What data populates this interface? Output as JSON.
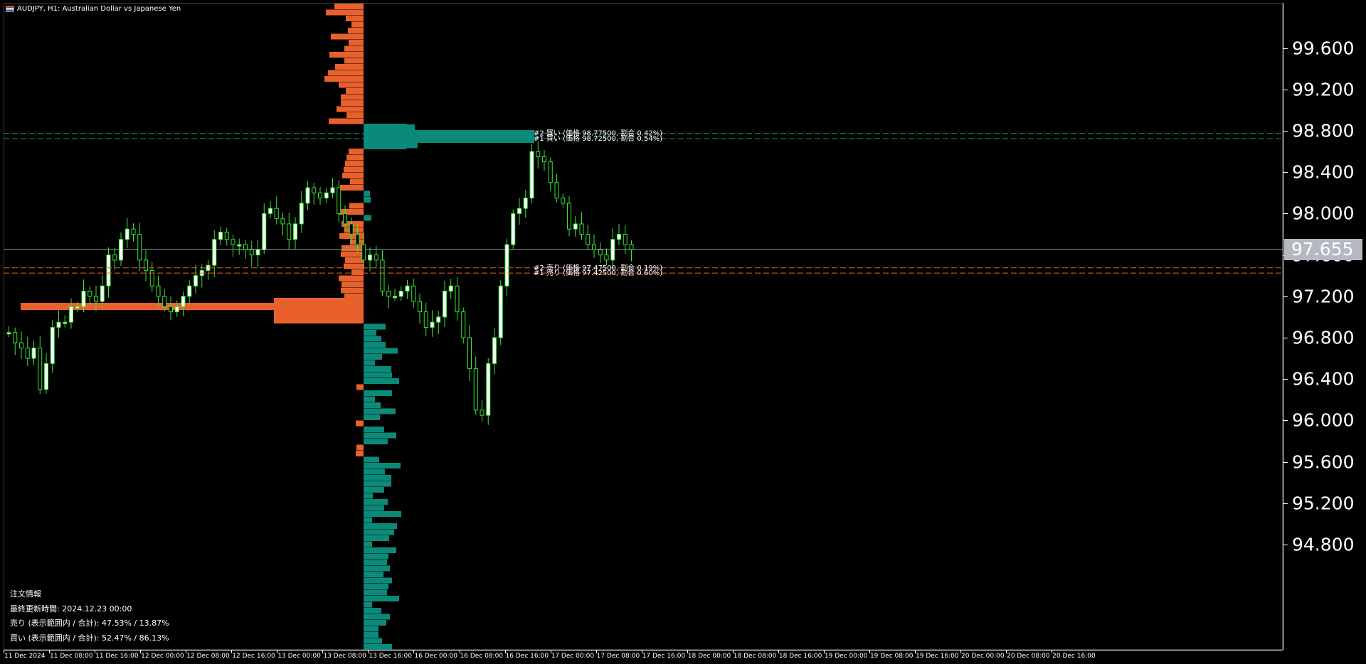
{
  "window_title": "AUDJPY, H1:  Australian Dollar vs Japanese Yen",
  "price_axis": {
    "labels": [
      "99.600",
      "99.200",
      "98.800",
      "98.400",
      "98.000",
      "97.600",
      "97.200",
      "96.800",
      "96.400",
      "96.000",
      "95.600",
      "95.200",
      "94.800"
    ],
    "current_price": "97.655"
  },
  "time_axis": {
    "labels": [
      "11 Dec 2024",
      "11 Dec 08:00",
      "11 Dec 16:00",
      "12 Dec 00:00",
      "12 Dec 08:00",
      "12 Dec 16:00",
      "13 Dec 00:00",
      "13 Dec 08:00",
      "13 Dec 16:00",
      "16 Dec 00:00",
      "16 Dec 08:00",
      "16 Dec 16:00",
      "17 Dec 00:00",
      "17 Dec 08:00",
      "17 Dec 16:00",
      "18 Dec 00:00",
      "18 Dec 08:00",
      "18 Dec 16:00",
      "19 Dec 00:00",
      "19 Dec 08:00",
      "19 Dec 16:00",
      "20 Dec 00:00",
      "20 Dec 08:00",
      "20 Dec 16:00"
    ]
  },
  "order_lines": {
    "buy": [
      {
        "label": "#2 買い (価格 98.77500, 割合 0.42%)",
        "price": 98.775
      },
      {
        "label": "#1 買い (価格 98.72500, 割合 0.54%)",
        "price": 98.725
      }
    ],
    "sell": [
      {
        "label": "#2 売り (価格 97.47500, 割合 0.19%)",
        "price": 97.475
      },
      {
        "label": "#1 売り (価格 97.42500, 割合 0.60%)",
        "price": 97.425
      }
    ]
  },
  "info_panel": {
    "title": "注文情報",
    "last_updated": "最終更新時間: 2024.12.23 00:00",
    "sell_ratio": "売り (表示範囲内 / 合計): 47.53% / 13.87%",
    "buy_ratio": "買い (表示範囲内 / 合計): 52.47% / 86.13%"
  },
  "colors": {
    "background": "#000000",
    "sell": "#e8612c",
    "buy": "#0b8a7a",
    "bull_candle": "#ffffff",
    "candle_wick": "#39e639",
    "current_line": "#8a9aa6"
  },
  "chart_data": {
    "type": "candlestick",
    "symbol": "AUDJPY",
    "timeframe": "H1",
    "ylim": [
      94.8,
      99.8
    ],
    "close_series": [
      96.85,
      96.75,
      96.7,
      96.6,
      96.7,
      96.3,
      96.55,
      96.9,
      96.95,
      96.95,
      97.1,
      97.1,
      97.25,
      97.2,
      97.15,
      97.3,
      97.6,
      97.55,
      97.75,
      97.85,
      97.8,
      97.55,
      97.45,
      97.3,
      97.2,
      97.1,
      97.05,
      97.1,
      97.2,
      97.3,
      97.4,
      97.45,
      97.5,
      97.75,
      97.82,
      97.75,
      97.7,
      97.7,
      97.65,
      97.6,
      97.65,
      98.0,
      98.05,
      97.95,
      97.9,
      97.75,
      97.9,
      98.1,
      98.25,
      98.2,
      98.15,
      98.2,
      98.25,
      98.0,
      97.9,
      97.8,
      97.7,
      97.55,
      97.6,
      97.55,
      97.25,
      97.2,
      97.2,
      97.25,
      97.3,
      97.15,
      97.05,
      96.9,
      96.95,
      97.0,
      97.25,
      97.3,
      97.05,
      96.8,
      96.5,
      96.1,
      96.05,
      96.55,
      96.8,
      97.3,
      97.7,
      98.0,
      98.05,
      98.15,
      98.6,
      98.55,
      98.5,
      98.3,
      98.15,
      98.1,
      97.85,
      97.9,
      97.8,
      97.7,
      97.65,
      97.6,
      97.55,
      97.75,
      97.8,
      97.7,
      97.65
    ],
    "order_levels": {
      "buy": [
        98.775,
        98.725
      ],
      "sell": [
        97.475,
        97.425
      ]
    }
  }
}
